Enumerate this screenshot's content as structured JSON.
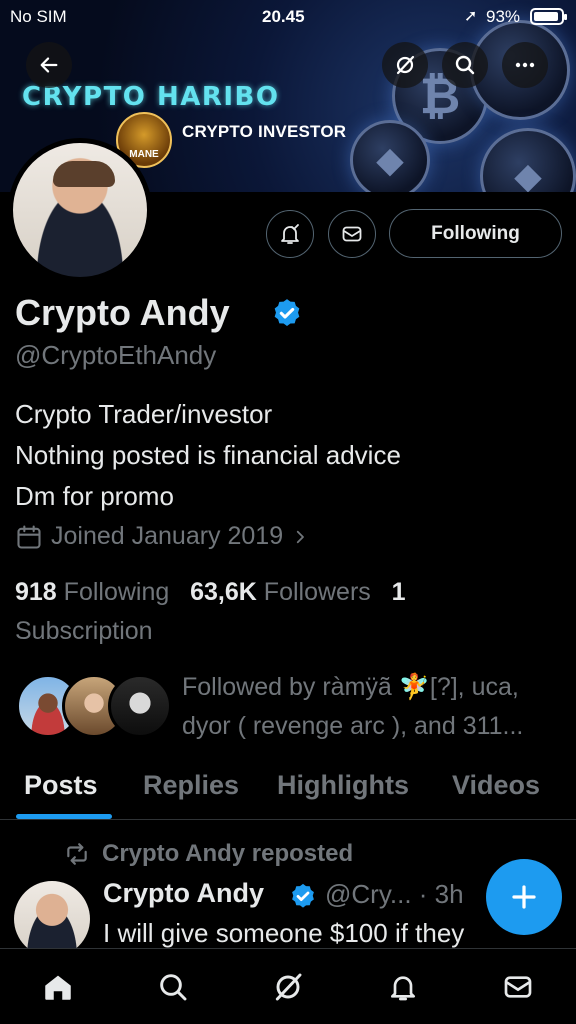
{
  "status_bar": {
    "carrier": "No SIM",
    "time": "20.45",
    "battery": "93%"
  },
  "banner": {
    "title": "CRYPTO HARIBO",
    "logo_text": "MANE",
    "subtitle": "CRYPTO INVESTOR"
  },
  "profile": {
    "name": "Crypto Andy",
    "handle": "@CryptoEthAndy",
    "bio_lines": [
      "Crypto Trader/investor",
      "Nothing posted is financial advice",
      "Dm for promo"
    ],
    "joined": "Joined January 2019",
    "following_count": "918",
    "following_label": "Following",
    "followers_count": "63,6K",
    "followers_label": "Followers",
    "subscription_count": "1",
    "subscription_label": "Subscription",
    "followed_by": "Followed by ràmÿã 🧚[?], uca, dyor ( revenge arc ), and 311..."
  },
  "actions": {
    "following_button": "Following"
  },
  "tabs": [
    "Posts",
    "Replies",
    "Highlights",
    "Videos"
  ],
  "post": {
    "reposted_label": "Crypto Andy reposted",
    "author": "Crypto Andy",
    "handle_time": "@Cry... · 3h",
    "text": "I will give someone $100 if they"
  },
  "colors": {
    "accent": "#1d9bf0",
    "muted": "#71767b",
    "text": "#e7e9ea",
    "background": "#000000"
  },
  "icons": {
    "back": "arrow-left-icon",
    "grok": "grok-icon",
    "search": "search-icon",
    "more": "more-icon",
    "notify": "bell-check-icon",
    "message": "envelope-icon",
    "verified": "verified-badge-icon",
    "calendar": "calendar-icon",
    "repost": "repost-icon",
    "compose": "plus-icon",
    "nav": [
      "home-icon",
      "search-icon",
      "grok-icon",
      "bell-icon",
      "envelope-icon"
    ]
  }
}
